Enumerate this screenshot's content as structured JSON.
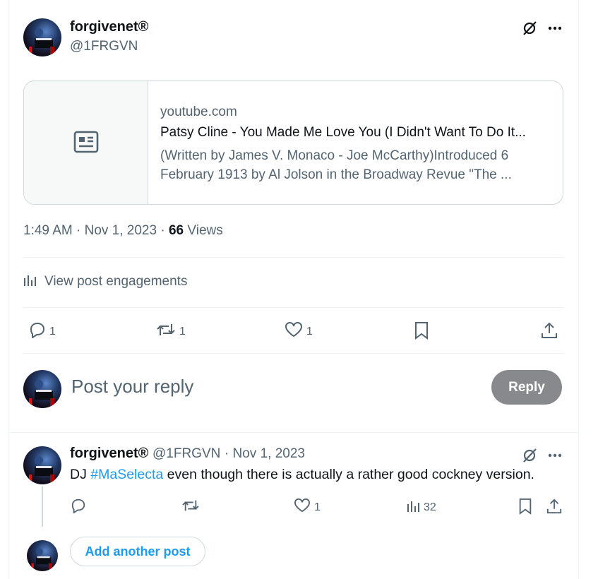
{
  "post": {
    "author_name": "forgivenet®",
    "author_handle": "@1FRGVN",
    "card": {
      "domain": "youtube.com",
      "title": "Patsy Cline - You Made Me Love You (I Didn't Want To Do It...",
      "description": "(Written by James V. Monaco - Joe McCarthy)Introduced 6 February 1913 by Al Jolson in the Broadway Revue \"The ..."
    },
    "time": "1:49 AM",
    "date": "Nov 1, 2023",
    "views_count": "66",
    "views_label": "Views",
    "engagements_label": "View post engagements",
    "actions": {
      "replies": "1",
      "reposts": "1",
      "likes": "1"
    }
  },
  "composer": {
    "placeholder": "Post your reply",
    "reply_label": "Reply"
  },
  "reply": {
    "author_name": "forgivenet®",
    "author_handle": "@1FRGVN",
    "date": "Nov 1, 2023",
    "text_prefix": "DJ ",
    "hashtag": "#MaSelecta",
    "text_suffix": " even though there is actually a rather good cockney version.",
    "actions": {
      "likes": "1",
      "views": "32"
    }
  },
  "add_post_label": "Add another post"
}
